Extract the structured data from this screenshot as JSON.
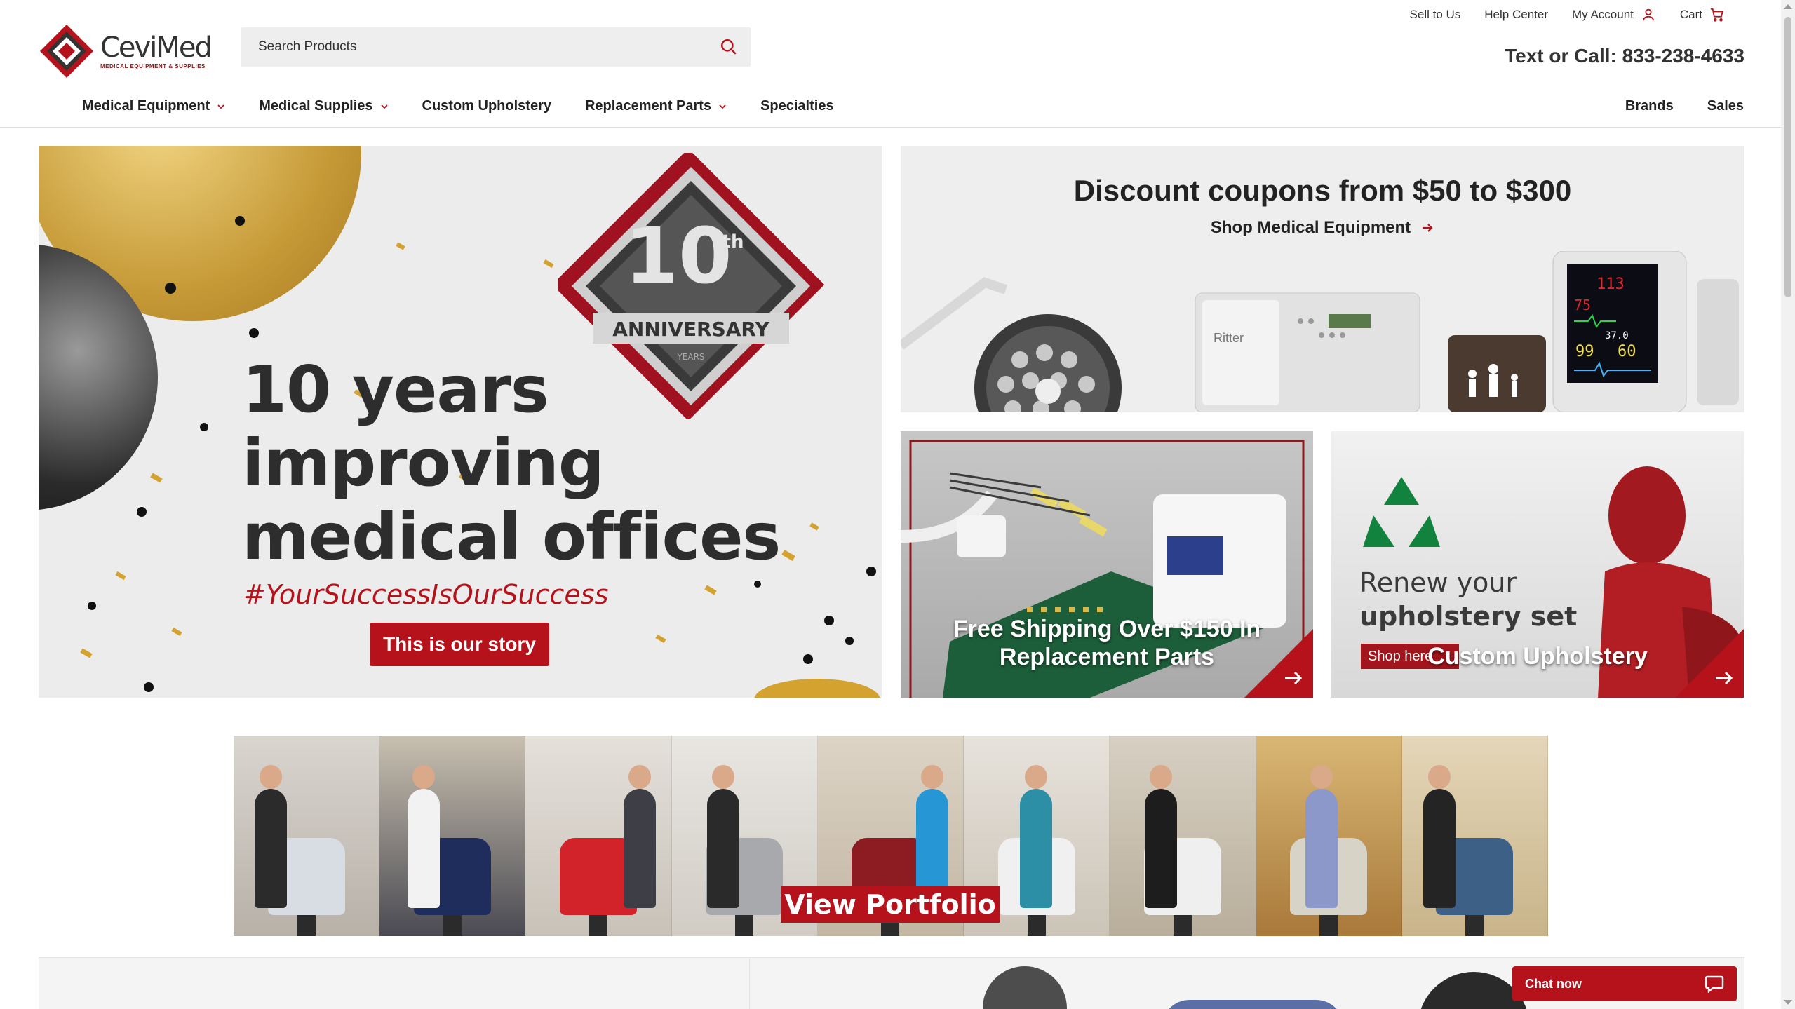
{
  "utility": {
    "sell": "Sell to Us",
    "help": "Help Center",
    "account": "My Account",
    "cart": "Cart"
  },
  "logo": {
    "brand": "CeviMed",
    "tagline": "MEDICAL EQUIPMENT & SUPPLIES"
  },
  "search": {
    "placeholder": "Search Products"
  },
  "phone": "Text or Call: 833-238-4633",
  "nav": {
    "medical_equipment": "Medical Equipment",
    "medical_supplies": "Medical Supplies",
    "custom_upholstery": "Custom Upholstery",
    "replacement_parts": "Replacement Parts",
    "specialties": "Specialties",
    "brands": "Brands",
    "sales": "Sales"
  },
  "hero": {
    "line1": "10 years",
    "line2": "improving",
    "line3": "medical offices",
    "hashtag": "#YourSuccessIsOurSuccess",
    "cta": "This is our story",
    "badge_number": "10",
    "badge_sup": "th",
    "badge_anniv": "ANNIVERSARY",
    "badge_years": "YEARS"
  },
  "discount": {
    "title": "Discount coupons from $50 to $300",
    "link": "Shop Medical Equipment",
    "monitor_values": [
      "113",
      "75",
      "37.0",
      "99",
      "60"
    ],
    "sterilizer_brand": "Ritter"
  },
  "tiles": {
    "shipping_line1": "Free Shipping Over $150 In",
    "shipping_line2": "Replacement Parts",
    "renew_line1": "Renew your",
    "renew_line2": "upholstery set",
    "renew_shop": "Shop here",
    "upholstery": "Custom Upholstery"
  },
  "portfolio": {
    "view": "View Portfolio"
  },
  "chat": {
    "label": "Chat now"
  },
  "colors": {
    "brand_red": "#b5121b",
    "text_dark": "#222222"
  }
}
